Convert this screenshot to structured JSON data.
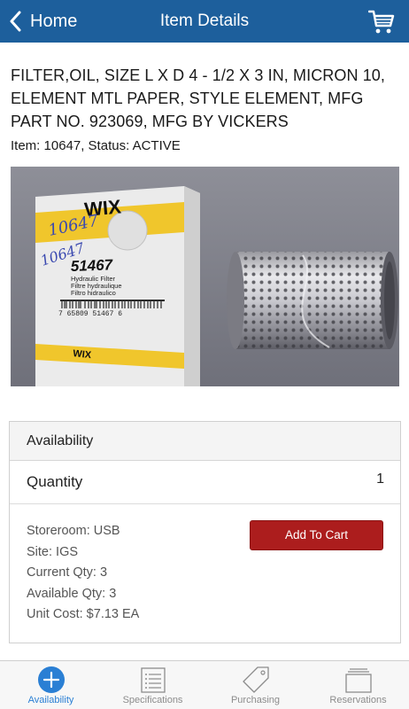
{
  "navbar": {
    "back_label": "Home",
    "title": "Item Details",
    "cart_icon": "shopping-cart-icon",
    "color": "#1d5f9c"
  },
  "item": {
    "description": "FILTER,OIL, SIZE L X D 4 - 1/2 X 3 IN, MICRON 10, ELEMENT MTL PAPER, STYLE ELEMENT, MFG PART NO. 923069, MFG BY VICKERS",
    "meta": "Item: 10647, Status: ACTIVE"
  },
  "photo": {
    "box_brand": "WIX",
    "box_part_number": "51467",
    "box_text_lines": [
      "Hydraulic Filter",
      "Filtre hydraulique",
      "Filtro hidraulico"
    ],
    "handwriting": [
      "10647",
      "10647"
    ],
    "barcode_digits": "7  65809 51467  6"
  },
  "availability": {
    "header": "Availability",
    "quantity_label": "Quantity",
    "quantity_value": "1",
    "storeroom": "Storeroom: USB",
    "site": "Site: IGS",
    "current_qty": "Current Qty: 3",
    "available_qty": "Available Qty: 3",
    "unit_cost": "Unit Cost: $7.13 EA",
    "add_to_cart_label": "Add To Cart",
    "button_color": "#ac1d1d"
  },
  "tabs": [
    {
      "label": "Availability",
      "icon": "plus-circle-icon",
      "active": true
    },
    {
      "label": "Specifications",
      "icon": "list-icon",
      "active": false
    },
    {
      "label": "Purchasing",
      "icon": "price-tag-icon",
      "active": false
    },
    {
      "label": "Reservations",
      "icon": "stacked-trays-icon",
      "active": false
    }
  ],
  "colors": {
    "tab_active": "#2a7fd4",
    "tab_inactive": "#8c8c8c"
  }
}
